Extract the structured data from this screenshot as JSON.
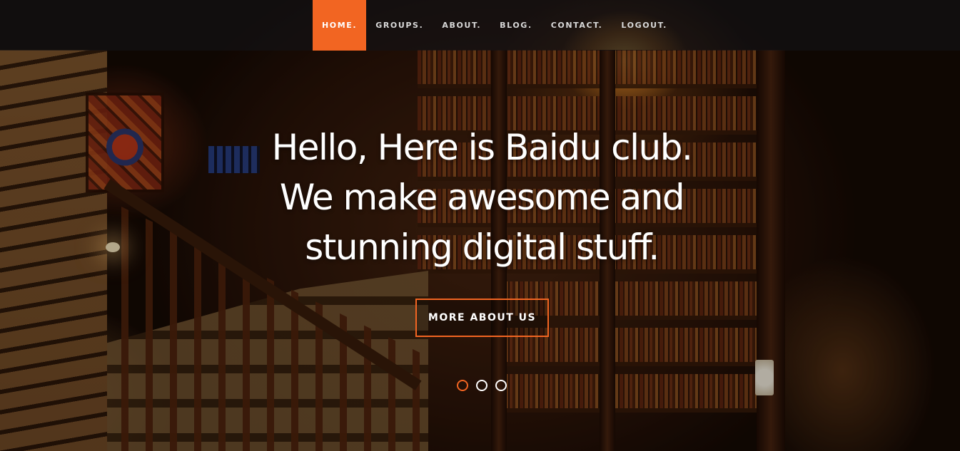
{
  "nav": {
    "items": [
      {
        "label": "HOME.",
        "active": true
      },
      {
        "label": "GROUPS.",
        "active": false
      },
      {
        "label": "ABOUT.",
        "active": false
      },
      {
        "label": "BLOG.",
        "active": false
      },
      {
        "label": "CONTACT.",
        "active": false
      },
      {
        "label": "LOGOUT.",
        "active": false
      }
    ]
  },
  "hero": {
    "headline_lines": [
      "Hello, Here is Baidu club.",
      "We make awesome and",
      "stunning digital stuff."
    ],
    "cta_label": "MORE ABOUT US"
  },
  "slider": {
    "slide_count": 3,
    "active_index": 0
  },
  "colors": {
    "accent": "#f26522",
    "text": "#ffffff",
    "nav_text": "#d9d9d9"
  }
}
